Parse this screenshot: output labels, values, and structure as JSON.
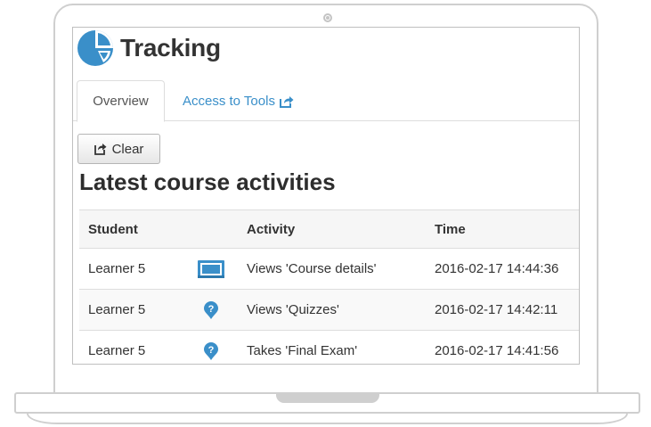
{
  "header": {
    "title": "Tracking",
    "logo_icon": "pie-chart-icon",
    "accent_color": "#3a8fc9"
  },
  "tabs": [
    {
      "label": "Overview",
      "active": true
    },
    {
      "label": "Access to Tools",
      "icon": "external-link-icon"
    }
  ],
  "toolbar": {
    "clear_label": "Clear",
    "clear_icon": "external-link-icon"
  },
  "section": {
    "title": "Latest course activities"
  },
  "table": {
    "columns": [
      "Student",
      "",
      "Activity",
      "Time"
    ],
    "rows": [
      {
        "student": "Learner 5",
        "icon": "presentation-icon",
        "activity": "Views 'Course details'",
        "time": "2016-02-17 14:44:36"
      },
      {
        "student": "Learner 5",
        "icon": "quiz-icon",
        "activity": "Views 'Quizzes'",
        "time": "2016-02-17 14:42:11"
      },
      {
        "student": "Learner 5",
        "icon": "quiz-icon",
        "activity": "Takes 'Final Exam'",
        "time": "2016-02-17 14:41:56"
      }
    ]
  }
}
